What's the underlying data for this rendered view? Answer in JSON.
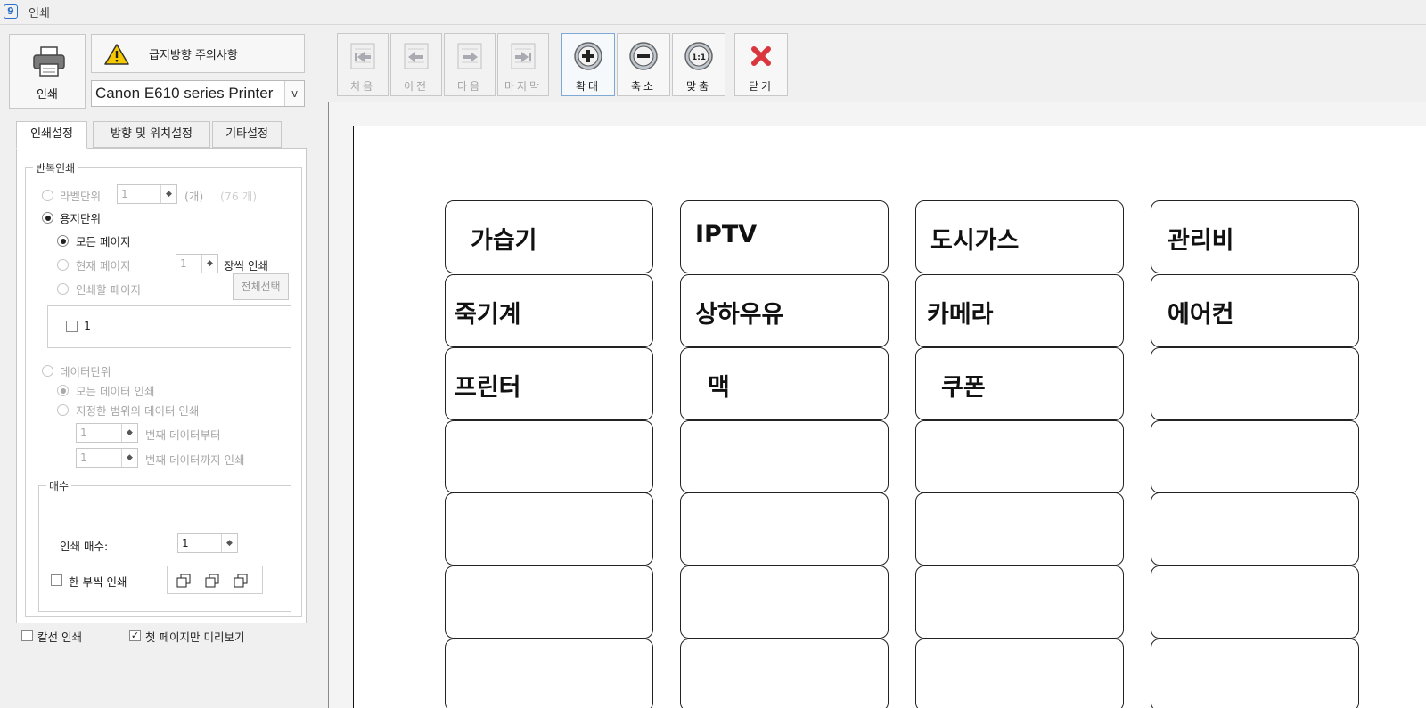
{
  "window": {
    "title": "인쇄",
    "icon": "app-icon",
    "icon_glyph": "9"
  },
  "left_panel": {
    "print_button": {
      "label": "인쇄",
      "icon": "printer-icon"
    },
    "warning_button": {
      "label": "급지방향 주의사항",
      "icon": "warning-icon"
    },
    "printer_select": {
      "value": "Canon E610 series Printer",
      "arrow": "v"
    },
    "tabs": [
      {
        "label": "인쇄설정",
        "active": true
      },
      {
        "label": "방향 및 위치설정",
        "active": false
      },
      {
        "label": "기타설정",
        "active": false
      }
    ],
    "repeat_print": {
      "title": "반복인쇄",
      "label_unit": {
        "label": "라벨단위",
        "value": "1",
        "unit": "(개)",
        "total": "(76 개)",
        "selected": false,
        "enabled": false
      },
      "paper_unit": {
        "label": "용지단위",
        "selected": true,
        "all_pages": {
          "label": "모든 페이지",
          "selected": true
        },
        "current_page": {
          "label": "현재 페이지",
          "value": "1",
          "suffix": "장씩 인쇄",
          "selected": false
        },
        "pages_to_print": {
          "label": "인쇄할 페이지",
          "select_all_label": "전체선택",
          "selected": false
        },
        "page_list": [
          {
            "label": "1",
            "checked": false
          }
        ]
      },
      "data_unit": {
        "label": "데이터단위",
        "selected": false,
        "all_data": {
          "label": "모든 데이터 인쇄",
          "selected": true
        },
        "range_data": {
          "label": "지정한 범위의 데이터 인쇄",
          "selected": false
        },
        "from": {
          "value": "1",
          "suffix": "번째 데이터부터"
        },
        "to": {
          "value": "1",
          "suffix": "번째 데이터까지 인쇄"
        }
      }
    },
    "copies": {
      "title": "매수",
      "count_label": "인쇄 매수:",
      "count_value": "1",
      "collate_label": "한 부씩 인쇄",
      "collate_checked": false,
      "collate_icon_labels": [
        "1",
        "2",
        "3"
      ]
    },
    "cut_line": {
      "label": "칼선 인쇄",
      "checked": false
    },
    "first_page_preview": {
      "label": "첫 페이지만 미리보기",
      "checked": true
    }
  },
  "toolbar": [
    {
      "name": "first",
      "label": "처음",
      "icon": "first-page-icon",
      "enabled": false
    },
    {
      "name": "prev",
      "label": "이전",
      "icon": "prev-page-icon",
      "enabled": false
    },
    {
      "name": "next",
      "label": "다음",
      "icon": "next-page-icon",
      "enabled": false
    },
    {
      "name": "last",
      "label": "마지막",
      "icon": "last-page-icon",
      "enabled": false
    },
    {
      "name": "zoom-in",
      "label": "확대",
      "icon": "zoom-in-icon",
      "enabled": true,
      "active": true
    },
    {
      "name": "zoom-out",
      "label": "축소",
      "icon": "zoom-out-icon",
      "enabled": true
    },
    {
      "name": "fit",
      "label": "맞춤",
      "icon": "fit-icon",
      "glyph": "1:1",
      "enabled": true
    },
    {
      "name": "close",
      "label": "닫기",
      "icon": "close-icon",
      "enabled": true
    }
  ],
  "preview": {
    "labels": [
      [
        "가습기",
        "IPTV",
        "도시가스",
        "관리비"
      ],
      [
        "죽기계",
        "상하우유",
        "카메라",
        "에어컨"
      ],
      [
        "프린터",
        "맥",
        "쿠폰",
        ""
      ],
      [
        "",
        "",
        "",
        ""
      ],
      [
        "",
        "",
        "",
        ""
      ],
      [
        "",
        "",
        "",
        ""
      ],
      [
        "",
        "",
        "",
        ""
      ]
    ]
  }
}
